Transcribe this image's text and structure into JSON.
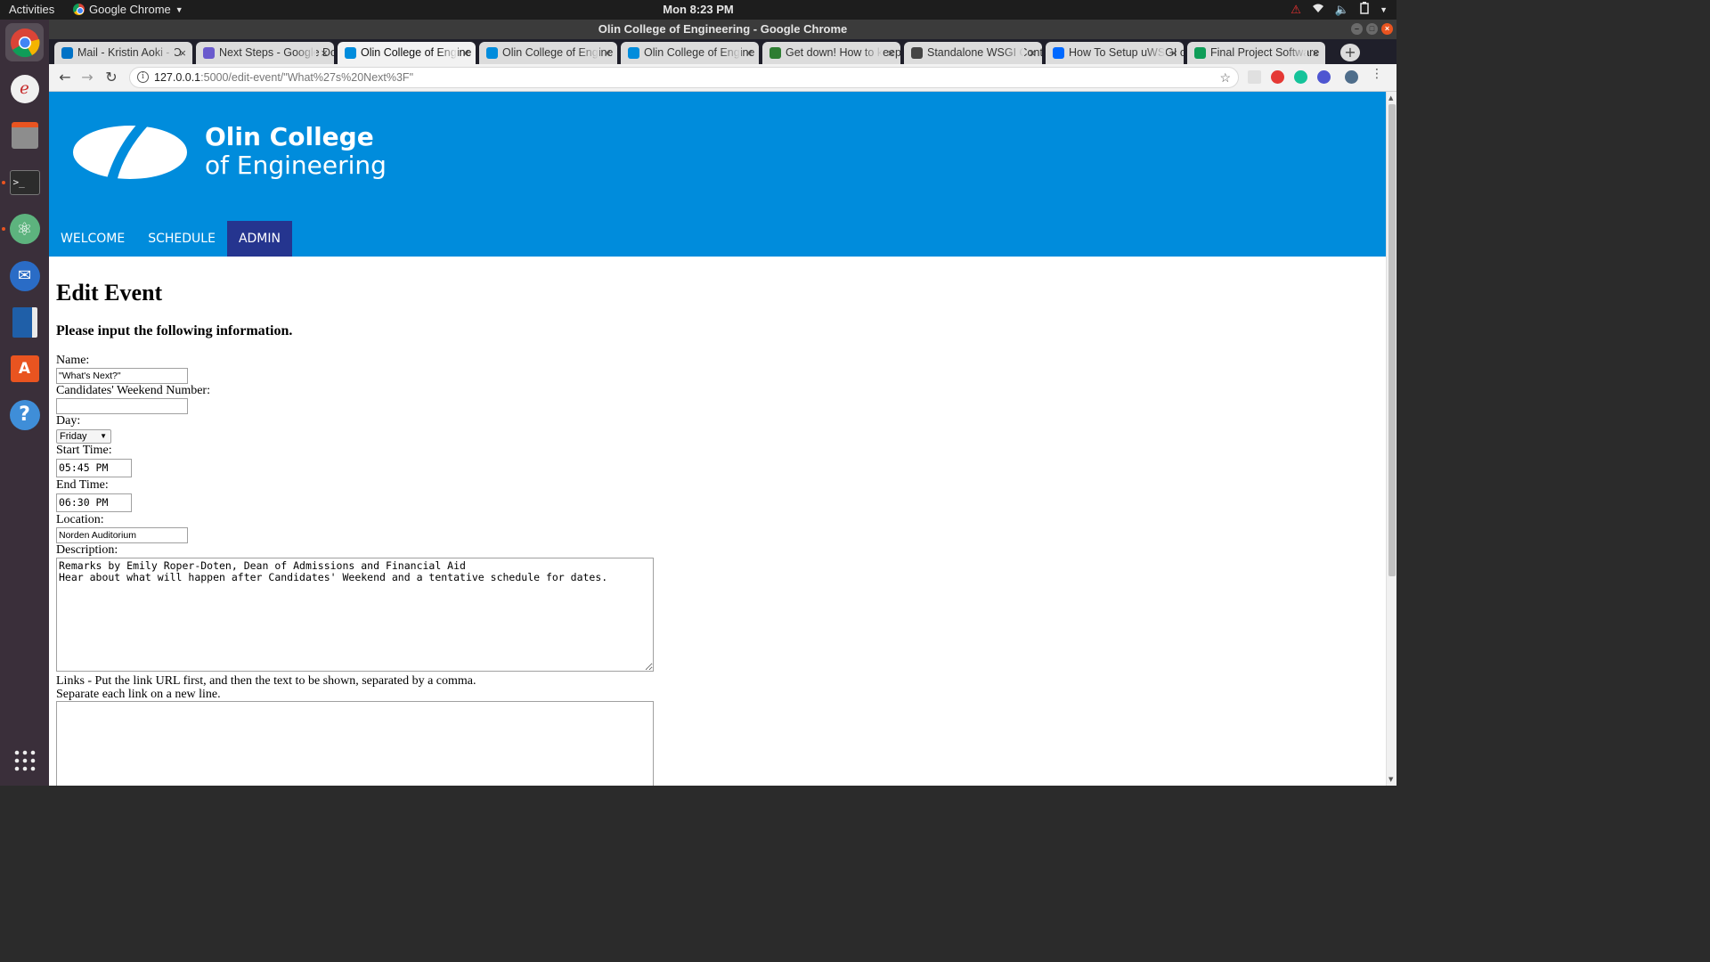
{
  "topbar": {
    "activities": "Activities",
    "app_name": "Google Chrome",
    "clock": "Mon  8:23 PM"
  },
  "window": {
    "title": "Olin College of Engineering - Google Chrome"
  },
  "tabs": [
    {
      "label": "Mail - Kristin Aoki - O",
      "favicon": "outlook-icon",
      "color": "#0072c6"
    },
    {
      "label": "Next Steps - Google Do",
      "favicon": "docs-icon",
      "color": "#6a5acd"
    },
    {
      "label": "Olin College of Engine",
      "favicon": "olin-icon",
      "color": "#008cdc",
      "active": true
    },
    {
      "label": "Olin College of Engine",
      "favicon": "olin-icon",
      "color": "#008cdc"
    },
    {
      "label": "Olin College of Engine",
      "favicon": "olin-icon",
      "color": "#008cdc"
    },
    {
      "label": "Get down! How to keep",
      "favicon": "avatar-icon",
      "color": "#2e7d32"
    },
    {
      "label": "Standalone WSGI Conta",
      "favicon": "phone-icon",
      "color": "#444444"
    },
    {
      "label": "How To Setup uWSGI o",
      "favicon": "digitalocean-icon",
      "color": "#0069ff"
    },
    {
      "label": "Final Project Software",
      "favicon": "drive-icon",
      "color": "#0f9d58"
    }
  ],
  "omnibox": {
    "host": "127.0.0.1",
    "path": ":5000/edit-event/\"What%27s%20Next%3F\""
  },
  "site": {
    "logo_line1": "Olin College",
    "logo_line2": "of Engineering",
    "nav": [
      {
        "label": "WELCOME"
      },
      {
        "label": "SCHEDULE"
      },
      {
        "label": "ADMIN",
        "active": true
      }
    ],
    "accent": "#008cdc",
    "nav_active_color": "#25358f"
  },
  "form": {
    "heading": "Edit Event",
    "subheading": "Please input the following information.",
    "name_label": "Name:",
    "name_value": "\"What's Next?\"",
    "weekend_label": "Candidates' Weekend Number:",
    "weekend_value": "",
    "day_label": "Day:",
    "day_value": "Friday",
    "start_label": "Start Time:",
    "start_value": "05:45 PM",
    "end_label": "End Time:",
    "end_value": "06:30 PM",
    "location_label": "Location:",
    "location_value": "Norden Auditorium",
    "description_label": "Description:",
    "description_value": "Remarks by Emily Roper-Doten, Dean of Admissions and Financial Aid\nHear about what will happen after Candidates' Weekend and a tentative schedule for dates.",
    "links_label_1": "Links - Put the link URL first, and then the text to be shown, separated by a comma.",
    "links_label_2": "Separate each link on a new line.",
    "links_value": ""
  }
}
